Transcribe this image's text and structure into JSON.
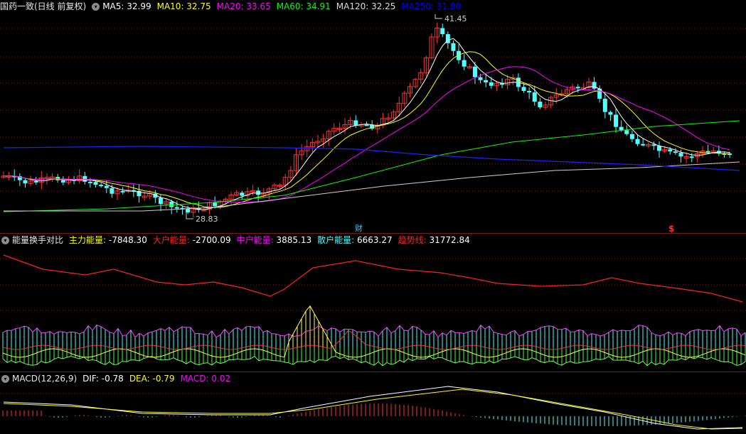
{
  "kline": {
    "stock_title": "国药一致(日线 前复权)",
    "ma": [
      {
        "label": "MA5: 32.99",
        "color": "#ffffff"
      },
      {
        "label": "MA10: 32.75",
        "color": "#ffff00"
      },
      {
        "label": "MA20: 33.65",
        "color": "#ff00ff"
      },
      {
        "label": "MA60: 34.91",
        "color": "#00ff00"
      },
      {
        "label": "MA120: 32.25",
        "color": "#dcdcdc"
      },
      {
        "label": "MA250: 31.80",
        "color": "#0000ff"
      }
    ],
    "high_label": "41.45",
    "low_label": "28.83",
    "marker_cai": "财",
    "marker_dollar": "$"
  },
  "energy": {
    "title": "能量换手对比",
    "items": [
      {
        "label": "主力能量: ",
        "value": "-7848.30",
        "color": "#ffff00"
      },
      {
        "label": "大户能量: ",
        "value": "-2700.09",
        "color": "#ff2020"
      },
      {
        "label": "中户能量: ",
        "value": "3885.13",
        "color": "#ff00ff"
      },
      {
        "label": "散户能量: ",
        "value": "6663.27",
        "color": "#40ffff"
      },
      {
        "label": "趋势线: ",
        "value": "31772.84",
        "color": "#ff2020"
      }
    ]
  },
  "macd": {
    "title": "MACD(12,26,9)",
    "items": [
      {
        "label": "DIF: ",
        "value": "-0.78",
        "color": "#ffffff"
      },
      {
        "label": "DEA: ",
        "value": "-0.79",
        "color": "#ffff00"
      },
      {
        "label": "MACD: ",
        "value": "0.02",
        "color": "#ff00ff"
      }
    ]
  },
  "colors": {
    "up": "#ff3232",
    "down": "#54ffff",
    "grid": "#7a1a1a",
    "bg": "#000000"
  }
}
